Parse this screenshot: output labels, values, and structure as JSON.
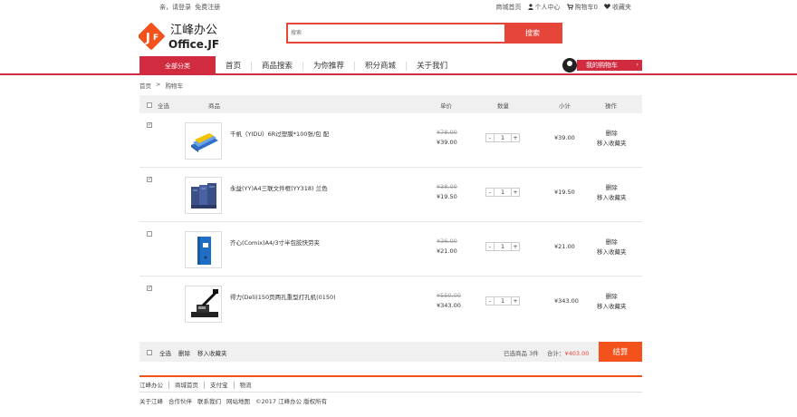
{
  "topbar": {
    "greeting": "亲，请登录",
    "register": "免费注册",
    "links": [
      {
        "label": "商城首页",
        "icon": ""
      },
      {
        "label": "个人中心",
        "icon": "user-icon"
      },
      {
        "label": "购物车0",
        "icon": "cart-icon"
      },
      {
        "label": "收藏夹",
        "icon": "heart-icon"
      }
    ]
  },
  "brand": {
    "name_cn": "江峰办公",
    "name_en": "Office.JF",
    "color": "#f3521d"
  },
  "search": {
    "placeholder": "搜索",
    "button": "搜索"
  },
  "nav": {
    "all_categories": "全部分类",
    "items": [
      "首页",
      "商品搜索",
      "为你推荐",
      "积分商城",
      "关于我们"
    ],
    "cart_label": "我的购物车",
    "accent": "#d02b3e"
  },
  "breadcrumb": [
    "首页",
    ">",
    "购物车"
  ],
  "table": {
    "headers": {
      "select_all": "全选",
      "product": "商品",
      "unit_price": "单价",
      "quantity": "数量",
      "subtotal": "小计",
      "actions": "操作"
    },
    "rows": [
      {
        "checked": true,
        "name": "千帆（YIDU）6R过塑膜*100张/包 配",
        "old_price": "¥78.00",
        "price": "¥39.00",
        "qty": "1",
        "subtotal": "¥39.00",
        "delete": "删除",
        "favorite": "移入收藏夹"
      },
      {
        "checked": true,
        "name": "永益(YY)A4三联文件框(YY318) 兰色",
        "old_price": "¥38.00",
        "price": "¥19.50",
        "qty": "1",
        "subtotal": "¥19.50",
        "delete": "删除",
        "favorite": "移入收藏夹"
      },
      {
        "checked": false,
        "name": "齐心(Comix)A4/3寸半包胶快劳夹",
        "old_price": "¥36.00",
        "price": "¥21.00",
        "qty": "1",
        "subtotal": "¥21.00",
        "delete": "删除",
        "favorite": "移入收藏夹"
      },
      {
        "checked": true,
        "name": "得力(Deli)150页两孔重型打孔机(0150)",
        "old_price": "¥550.00",
        "price": "¥343.00",
        "qty": "1",
        "subtotal": "¥343.00",
        "delete": "删除",
        "favorite": "移入收藏夹"
      }
    ],
    "qty_minus": "-",
    "qty_plus": "+"
  },
  "summary": {
    "select_all": "全选",
    "delete": "删除",
    "favorite": "移入收藏夹",
    "selected_label": "已选商品",
    "selected_count": "3件",
    "total_label": "合计：",
    "total_value": "¥403.00",
    "checkout": "结算",
    "checkout_color": "#f3521d"
  },
  "footer": {
    "links": [
      "江峰办公",
      "商城首页",
      "支付宝",
      "物流"
    ],
    "bottom": [
      "关于江峰",
      "合作伙伴",
      "联系我们",
      "网站地图",
      "©2017 江峰办公 版权所有"
    ]
  }
}
